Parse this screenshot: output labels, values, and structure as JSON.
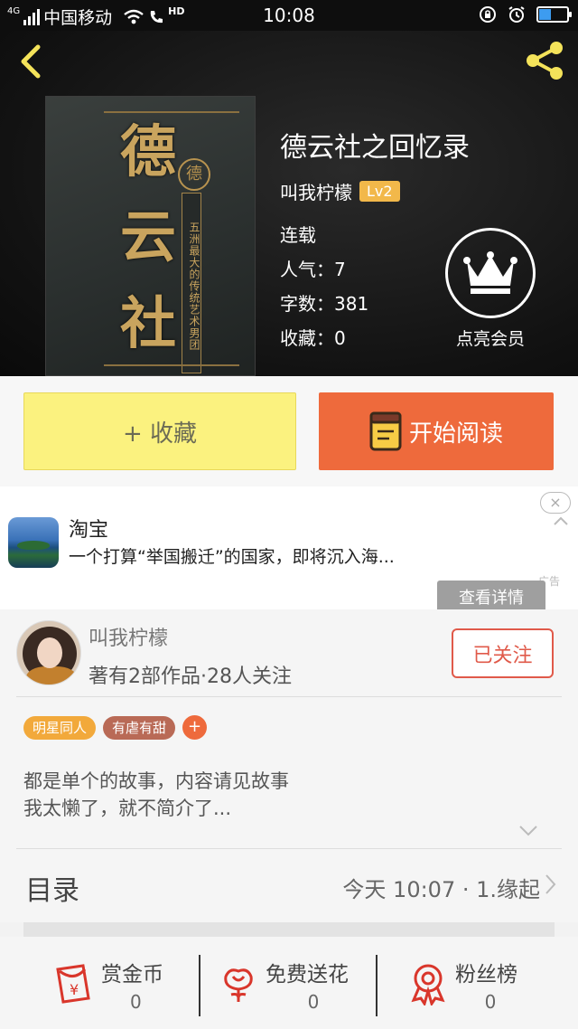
{
  "status_bar": {
    "network": "4G",
    "carrier": "中国移动",
    "hd": "HD",
    "time": "10:08"
  },
  "book": {
    "title": "德云社之回忆录",
    "author": "叫我柠檬",
    "level": "Lv2",
    "status": "连载",
    "popularity": "人气：7",
    "word_count": "字数：381",
    "favorites": "收藏：0",
    "cover": {
      "char1": "德",
      "char2": "云",
      "char3": "社",
      "seal": "德",
      "vertical_text": "五洲最大的传统艺术男团"
    }
  },
  "vip": {
    "label": "点亮会员"
  },
  "actions": {
    "favorite_label": "+ 收藏",
    "read_label": "开始阅读"
  },
  "ad": {
    "brand": "淘宝",
    "description": "一个打算“举国搬迁”的国家，即将沉入海...",
    "close_icon": "×",
    "tag": "广告",
    "detail_button": "查看详情"
  },
  "author_card": {
    "name": "叫我柠檬",
    "stats": "著有2部作品·28人关注",
    "follow_label": "已关注"
  },
  "tags": [
    {
      "label": "明星同人",
      "color": "#f2a93b"
    },
    {
      "label": "有虐有甜",
      "color": "#b96a56"
    }
  ],
  "tag_add": "+",
  "intro": {
    "line1": "都是单个的故事，内容请见故事",
    "line2": "我太懒了，就不简介了..."
  },
  "toc": {
    "label": "目录",
    "latest": "今天 10:07 · 1.缘起"
  },
  "bottom_bar": {
    "reward": {
      "label": "赏金币",
      "count": "0"
    },
    "flower": {
      "label": "免费送花",
      "count": "0"
    },
    "fans": {
      "label": "粉丝榜",
      "count": "0"
    }
  },
  "colors": {
    "accent_orange": "#ee6a3c",
    "favorite_yellow": "#fbf27f",
    "level_badge": "#f2b84a",
    "header_icons": "#f4e35a",
    "bottom_icons": "#d9362b"
  }
}
